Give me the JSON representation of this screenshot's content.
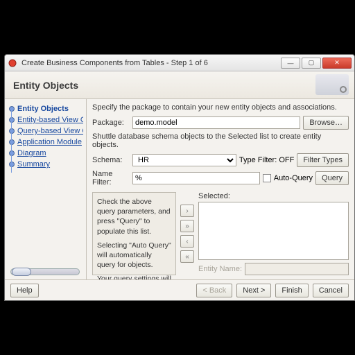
{
  "window": {
    "title": "Create Business Components from Tables - Step 1 of 6"
  },
  "header": {
    "title": "Entity Objects"
  },
  "nav": {
    "items": [
      {
        "label": "Entity Objects"
      },
      {
        "label": "Entity-based View Obje"
      },
      {
        "label": "Query-based View Obje"
      },
      {
        "label": "Application Module"
      },
      {
        "label": "Diagram"
      },
      {
        "label": "Summary"
      }
    ]
  },
  "main": {
    "intro": "Specify the package to contain your new entity objects and associations.",
    "package_label": "Package:",
    "package_value": "demo.model",
    "browse_label": "Browse…",
    "shuttle_instruction": "Shuttle database schema objects to the Selected list to create entity objects.",
    "schema_label": "Schema:",
    "schema_value": "HR",
    "type_filter_label": "Type Filter: OFF",
    "filter_types_label": "Filter Types",
    "name_filter_label": "Name Filter:",
    "name_filter_value": "%",
    "auto_query_label": "Auto-Query",
    "query_label": "Query",
    "hint_p1": "Check the above query parameters, and press \"Query\" to populate this list.",
    "hint_p2": "Selecting \"Auto Query\" will automatically query for objects.",
    "hint_p3": "Your query settings will be remembered for this panel.",
    "selected_label": "Selected:",
    "entity_name_label": "Entity Name:",
    "entity_name_value": ""
  },
  "footer": {
    "help": "Help",
    "back": "< Back",
    "next": "Next >",
    "finish": "Finish",
    "cancel": "Cancel"
  }
}
